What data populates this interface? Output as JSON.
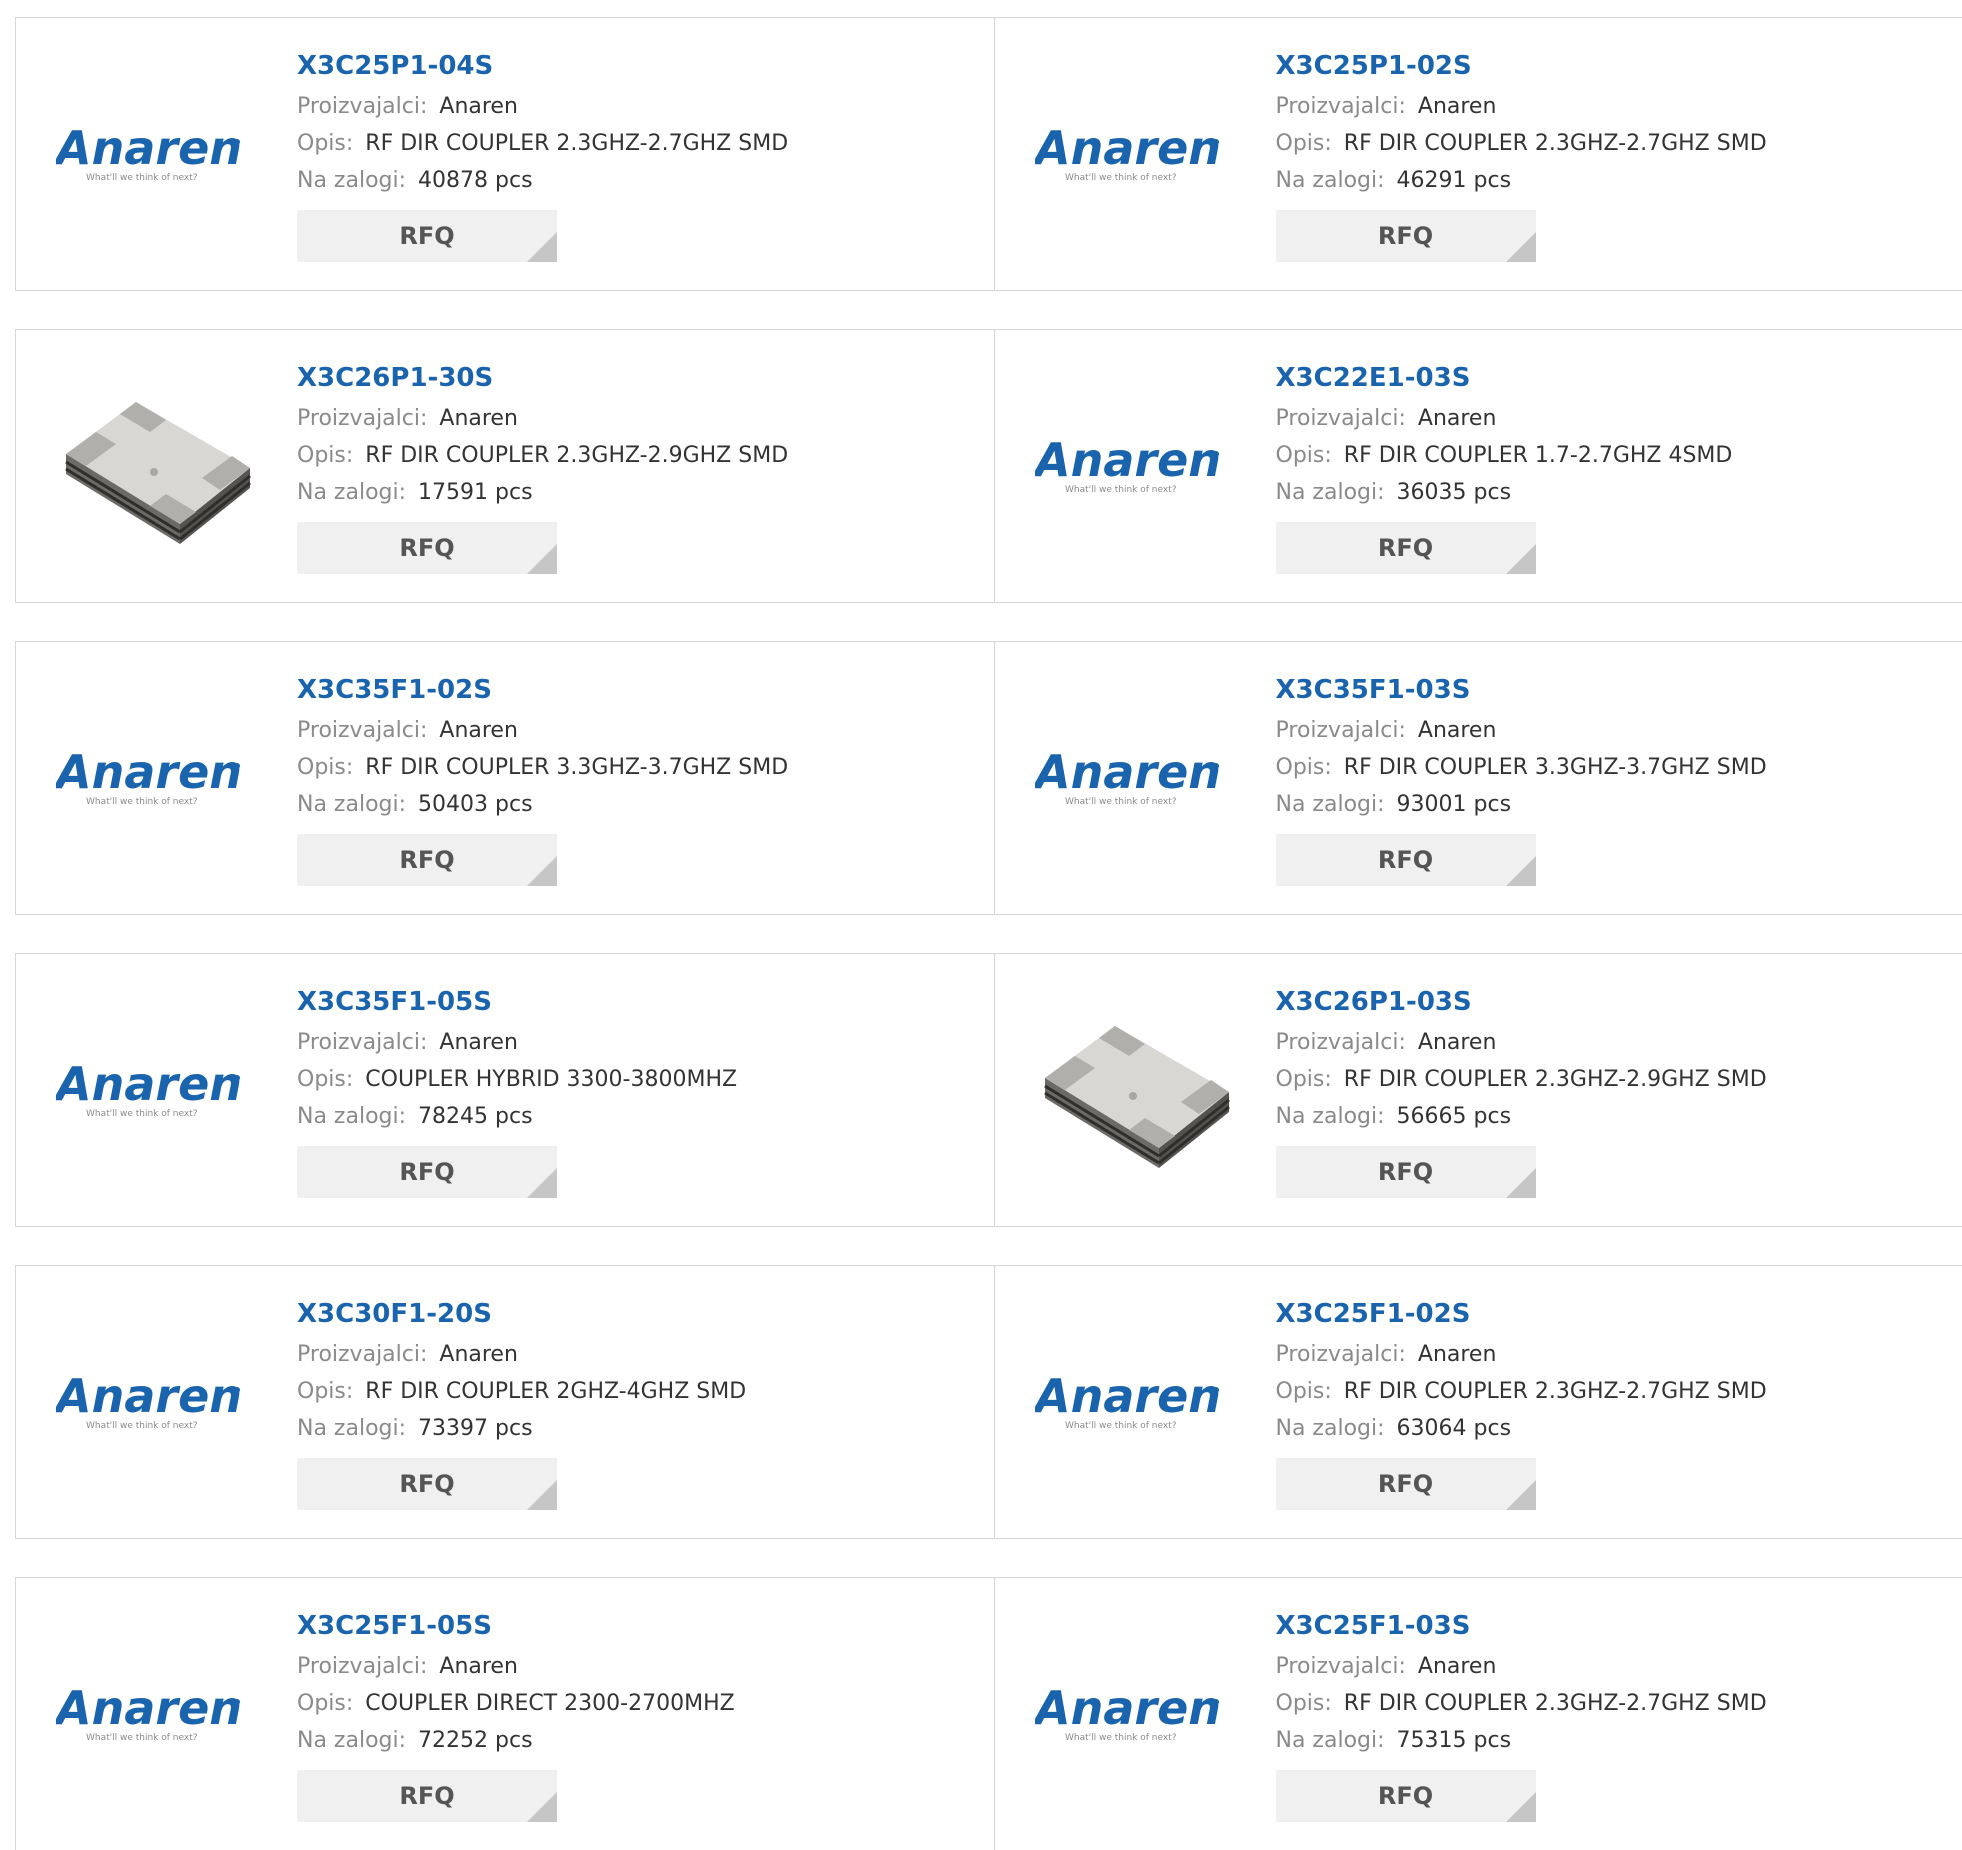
{
  "labels": {
    "manufacturer": "Proizvajalci:",
    "description": "Opis:",
    "stock": "Na zalogi:",
    "rfq": "RFQ"
  },
  "logo": {
    "wordmark": "Anaren",
    "tagline": "What'll we think of next?"
  },
  "products": [
    {
      "part": "X3C25P1-04S",
      "manufacturer": "Anaren",
      "description": "RF DIR COUPLER 2.3GHZ-2.7GHZ SMD",
      "stock": "40878 pcs",
      "image": "anaren-logo"
    },
    {
      "part": "X3C25P1-02S",
      "manufacturer": "Anaren",
      "description": "RF DIR COUPLER 2.3GHZ-2.7GHZ SMD",
      "stock": "46291 pcs",
      "image": "anaren-logo"
    },
    {
      "part": "X3C26P1-30S",
      "manufacturer": "Anaren",
      "description": "RF DIR COUPLER 2.3GHZ-2.9GHZ SMD",
      "stock": "17591 pcs",
      "image": "chip-photo"
    },
    {
      "part": "X3C22E1-03S",
      "manufacturer": "Anaren",
      "description": "RF DIR COUPLER 1.7-2.7GHZ 4SMD",
      "stock": "36035 pcs",
      "image": "anaren-logo"
    },
    {
      "part": "X3C35F1-02S",
      "manufacturer": "Anaren",
      "description": "RF DIR COUPLER 3.3GHZ-3.7GHZ SMD",
      "stock": "50403 pcs",
      "image": "anaren-logo"
    },
    {
      "part": "X3C35F1-03S",
      "manufacturer": "Anaren",
      "description": "RF DIR COUPLER 3.3GHZ-3.7GHZ SMD",
      "stock": "93001 pcs",
      "image": "anaren-logo"
    },
    {
      "part": "X3C35F1-05S",
      "manufacturer": "Anaren",
      "description": "COUPLER HYBRID 3300-3800MHZ",
      "stock": "78245 pcs",
      "image": "anaren-logo"
    },
    {
      "part": "X3C26P1-03S",
      "manufacturer": "Anaren",
      "description": "RF DIR COUPLER 2.3GHZ-2.9GHZ SMD",
      "stock": "56665 pcs",
      "image": "chip-photo"
    },
    {
      "part": "X3C30F1-20S",
      "manufacturer": "Anaren",
      "description": "RF DIR COUPLER 2GHZ-4GHZ SMD",
      "stock": "73397 pcs",
      "image": "anaren-logo"
    },
    {
      "part": "X3C25F1-02S",
      "manufacturer": "Anaren",
      "description": "RF DIR COUPLER 2.3GHZ-2.7GHZ SMD",
      "stock": "63064 pcs",
      "image": "anaren-logo"
    },
    {
      "part": "X3C25F1-05S",
      "manufacturer": "Anaren",
      "description": "COUPLER DIRECT 2300-2700MHZ",
      "stock": "72252 pcs",
      "image": "anaren-logo"
    },
    {
      "part": "X3C25F1-03S",
      "manufacturer": "Anaren",
      "description": "RF DIR COUPLER 2.3GHZ-2.7GHZ SMD",
      "stock": "75315 pcs",
      "image": "anaren-logo"
    }
  ],
  "colors": {
    "link": "#1a63ad",
    "brand": "#1a63ad",
    "label": "#8a8a8a",
    "button": "#f0f0f0"
  }
}
